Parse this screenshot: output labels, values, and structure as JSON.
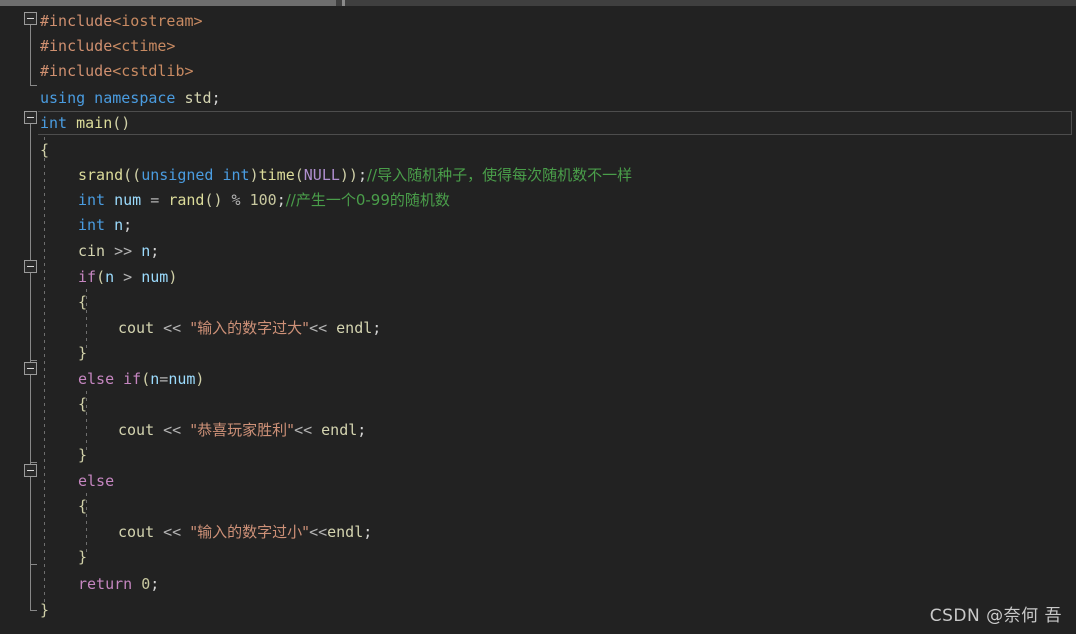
{
  "window": {
    "title": "C++ code editor",
    "theme": "dark",
    "background_color": "#222222",
    "scrollbar": {
      "orientation": "horizontal",
      "position": "top",
      "track_color": "#3f3f3f",
      "thumb_color": "#6e6e6e"
    }
  },
  "watermark": {
    "text": "CSDN @奈何 吾"
  },
  "colors": {
    "preprocessor": "#d09070",
    "header": "#c88a62",
    "keyword": "#4a9ce0",
    "control_keyword": "#c586c0",
    "function": "#dcdc9a",
    "variable": "#9cdcfe",
    "number": "#c8c8a0",
    "string": "#ce9178",
    "comment": "#4a9e4a",
    "macro": "#b08fd0",
    "stdlib": "#d4d4b0",
    "brace": "#d0d0a8",
    "plain": "#d4d4d4"
  },
  "editor": {
    "language": "C++",
    "current_line_number": 5,
    "current_line_text": "int main()",
    "fold_markers": [
      {
        "line": 1,
        "state": "expanded",
        "glyph": "minus"
      },
      {
        "line": 5,
        "state": "expanded",
        "glyph": "minus"
      },
      {
        "line": 11,
        "state": "expanded",
        "glyph": "minus"
      },
      {
        "line": 15,
        "state": "expanded",
        "glyph": "minus"
      },
      {
        "line": 19,
        "state": "expanded",
        "glyph": "minus"
      }
    ],
    "lines": [
      {
        "n": 1,
        "indent": 0,
        "text": "#include<iostream>"
      },
      {
        "n": 2,
        "indent": 0,
        "text": "#include<ctime>"
      },
      {
        "n": 3,
        "indent": 0,
        "text": "#include<cstdlib>"
      },
      {
        "n": 4,
        "indent": 0,
        "text": "using namespace std;"
      },
      {
        "n": 5,
        "indent": 0,
        "text": "int main()"
      },
      {
        "n": 6,
        "indent": 0,
        "text": "{"
      },
      {
        "n": 7,
        "indent": 1,
        "text": "srand((unsigned int)time(NULL));//导入随机种子，使得每次随机数不一样"
      },
      {
        "n": 8,
        "indent": 1,
        "text": "int num = rand() % 100;//产生一个0-99的随机数"
      },
      {
        "n": 9,
        "indent": 1,
        "text": "int n;"
      },
      {
        "n": 10,
        "indent": 1,
        "text": "cin >> n;"
      },
      {
        "n": 11,
        "indent": 1,
        "text": "if(n > num)"
      },
      {
        "n": 12,
        "indent": 1,
        "text": "{"
      },
      {
        "n": 13,
        "indent": 2,
        "text": "cout << \"输入的数字过大\"<< endl;"
      },
      {
        "n": 14,
        "indent": 1,
        "text": "}"
      },
      {
        "n": 15,
        "indent": 1,
        "text": "else if(n=num)"
      },
      {
        "n": 16,
        "indent": 1,
        "text": "{"
      },
      {
        "n": 17,
        "indent": 2,
        "text": "cout << \"恭喜玩家胜利\"<< endl;"
      },
      {
        "n": 18,
        "indent": 1,
        "text": "}"
      },
      {
        "n": 19,
        "indent": 1,
        "text": "else"
      },
      {
        "n": 20,
        "indent": 1,
        "text": "{"
      },
      {
        "n": 21,
        "indent": 2,
        "text": "cout << \"输入的数字过小\"<<endl;"
      },
      {
        "n": 22,
        "indent": 1,
        "text": "}"
      },
      {
        "n": 23,
        "indent": 1,
        "text": "return 0;"
      },
      {
        "n": 24,
        "indent": 0,
        "text": "}"
      }
    ],
    "comments": [
      "//导入随机种子，使得每次随机数不一样",
      "//产生一个0-99的随机数"
    ],
    "strings": [
      "\"输入的数字过大\"",
      "\"恭喜玩家胜利\"",
      "\"输入的数字过小\""
    ]
  }
}
